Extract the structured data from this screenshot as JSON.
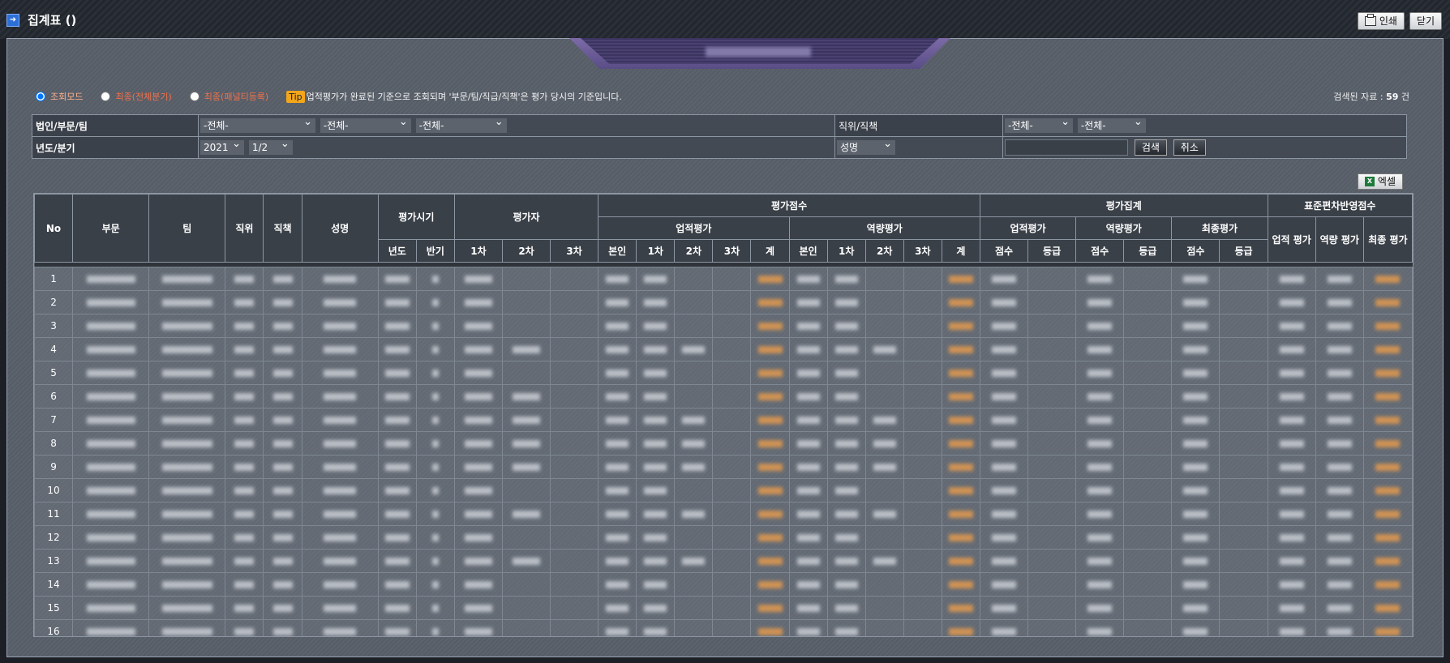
{
  "window": {
    "title": "집계표 ()",
    "print_label": "인쇄",
    "close_label": "닫기"
  },
  "radios": [
    {
      "label": "조회모드",
      "checked": true
    },
    {
      "label": "최종(전체분기)",
      "checked": false
    },
    {
      "label": "최종(패널티등록)",
      "checked": false
    }
  ],
  "tip": {
    "badge": "Tip",
    "text": "업적평가가 완료된 기준으로 조회되며 '부문/팀/직급/직책'은 평가 당시의 기준입니다."
  },
  "count": {
    "prefix": "검색된 자료 :",
    "value": "59",
    "suffix": "건"
  },
  "filter": {
    "org_label": "법인/부문/팀",
    "org_selects": [
      "-전체-",
      "-전체-",
      "-전체-"
    ],
    "pos_label": "직위/직책",
    "pos_selects": [
      "-전체-",
      "-전체-"
    ],
    "period_label": "년도/분기",
    "year": "2021",
    "half": "1/2",
    "name_select": "성명",
    "search_label": "검색",
    "cancel_label": "취소"
  },
  "excel_label": "엑셀",
  "headers": {
    "no": "No",
    "dept": "부문",
    "team": "팀",
    "rank": "직위",
    "duty": "직책",
    "name": "성명",
    "period": "평가시기",
    "year": "년도",
    "half": "반기",
    "evaluator": "평가자",
    "e1": "1차",
    "e2": "2차",
    "e3": "3차",
    "score": "평가점수",
    "perf": "업적평가",
    "comp": "역량평가",
    "self": "본인",
    "sum": "계",
    "agg": "평가집계",
    "final": "최종평가",
    "pts": "점수",
    "grade": "등급",
    "std": "표준편차반영점수",
    "std_perf": "업적 평가",
    "std_comp": "역량 평가",
    "std_final": "최종 평가"
  },
  "rows": [
    "1",
    "2",
    "3",
    "4",
    "5",
    "6",
    "7",
    "8",
    "9",
    "10",
    "11",
    "12",
    "13",
    "14",
    "15",
    "16"
  ]
}
